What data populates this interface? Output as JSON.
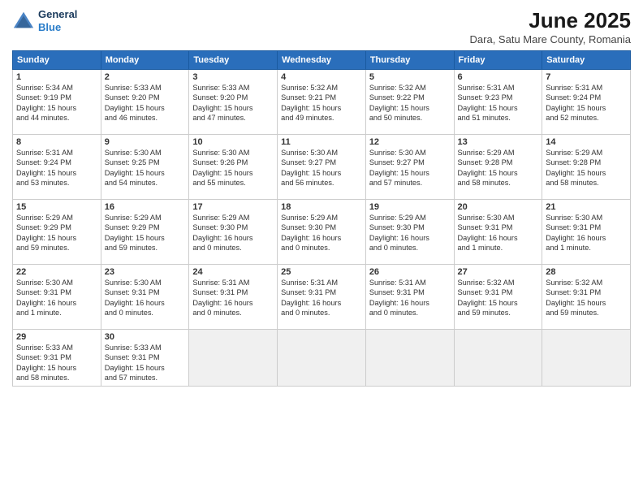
{
  "header": {
    "logo_line1": "General",
    "logo_line2": "Blue",
    "month": "June 2025",
    "location": "Dara, Satu Mare County, Romania"
  },
  "weekdays": [
    "Sunday",
    "Monday",
    "Tuesday",
    "Wednesday",
    "Thursday",
    "Friday",
    "Saturday"
  ],
  "weeks": [
    [
      {
        "day": "1",
        "text": "Sunrise: 5:34 AM\nSunset: 9:19 PM\nDaylight: 15 hours\nand 44 minutes."
      },
      {
        "day": "2",
        "text": "Sunrise: 5:33 AM\nSunset: 9:20 PM\nDaylight: 15 hours\nand 46 minutes."
      },
      {
        "day": "3",
        "text": "Sunrise: 5:33 AM\nSunset: 9:20 PM\nDaylight: 15 hours\nand 47 minutes."
      },
      {
        "day": "4",
        "text": "Sunrise: 5:32 AM\nSunset: 9:21 PM\nDaylight: 15 hours\nand 49 minutes."
      },
      {
        "day": "5",
        "text": "Sunrise: 5:32 AM\nSunset: 9:22 PM\nDaylight: 15 hours\nand 50 minutes."
      },
      {
        "day": "6",
        "text": "Sunrise: 5:31 AM\nSunset: 9:23 PM\nDaylight: 15 hours\nand 51 minutes."
      },
      {
        "day": "7",
        "text": "Sunrise: 5:31 AM\nSunset: 9:24 PM\nDaylight: 15 hours\nand 52 minutes."
      }
    ],
    [
      {
        "day": "8",
        "text": "Sunrise: 5:31 AM\nSunset: 9:24 PM\nDaylight: 15 hours\nand 53 minutes."
      },
      {
        "day": "9",
        "text": "Sunrise: 5:30 AM\nSunset: 9:25 PM\nDaylight: 15 hours\nand 54 minutes."
      },
      {
        "day": "10",
        "text": "Sunrise: 5:30 AM\nSunset: 9:26 PM\nDaylight: 15 hours\nand 55 minutes."
      },
      {
        "day": "11",
        "text": "Sunrise: 5:30 AM\nSunset: 9:27 PM\nDaylight: 15 hours\nand 56 minutes."
      },
      {
        "day": "12",
        "text": "Sunrise: 5:30 AM\nSunset: 9:27 PM\nDaylight: 15 hours\nand 57 minutes."
      },
      {
        "day": "13",
        "text": "Sunrise: 5:29 AM\nSunset: 9:28 PM\nDaylight: 15 hours\nand 58 minutes."
      },
      {
        "day": "14",
        "text": "Sunrise: 5:29 AM\nSunset: 9:28 PM\nDaylight: 15 hours\nand 58 minutes."
      }
    ],
    [
      {
        "day": "15",
        "text": "Sunrise: 5:29 AM\nSunset: 9:29 PM\nDaylight: 15 hours\nand 59 minutes."
      },
      {
        "day": "16",
        "text": "Sunrise: 5:29 AM\nSunset: 9:29 PM\nDaylight: 15 hours\nand 59 minutes."
      },
      {
        "day": "17",
        "text": "Sunrise: 5:29 AM\nSunset: 9:30 PM\nDaylight: 16 hours\nand 0 minutes."
      },
      {
        "day": "18",
        "text": "Sunrise: 5:29 AM\nSunset: 9:30 PM\nDaylight: 16 hours\nand 0 minutes."
      },
      {
        "day": "19",
        "text": "Sunrise: 5:29 AM\nSunset: 9:30 PM\nDaylight: 16 hours\nand 0 minutes."
      },
      {
        "day": "20",
        "text": "Sunrise: 5:30 AM\nSunset: 9:31 PM\nDaylight: 16 hours\nand 1 minute."
      },
      {
        "day": "21",
        "text": "Sunrise: 5:30 AM\nSunset: 9:31 PM\nDaylight: 16 hours\nand 1 minute."
      }
    ],
    [
      {
        "day": "22",
        "text": "Sunrise: 5:30 AM\nSunset: 9:31 PM\nDaylight: 16 hours\nand 1 minute."
      },
      {
        "day": "23",
        "text": "Sunrise: 5:30 AM\nSunset: 9:31 PM\nDaylight: 16 hours\nand 0 minutes."
      },
      {
        "day": "24",
        "text": "Sunrise: 5:31 AM\nSunset: 9:31 PM\nDaylight: 16 hours\nand 0 minutes."
      },
      {
        "day": "25",
        "text": "Sunrise: 5:31 AM\nSunset: 9:31 PM\nDaylight: 16 hours\nand 0 minutes."
      },
      {
        "day": "26",
        "text": "Sunrise: 5:31 AM\nSunset: 9:31 PM\nDaylight: 16 hours\nand 0 minutes."
      },
      {
        "day": "27",
        "text": "Sunrise: 5:32 AM\nSunset: 9:31 PM\nDaylight: 15 hours\nand 59 minutes."
      },
      {
        "day": "28",
        "text": "Sunrise: 5:32 AM\nSunset: 9:31 PM\nDaylight: 15 hours\nand 59 minutes."
      }
    ],
    [
      {
        "day": "29",
        "text": "Sunrise: 5:33 AM\nSunset: 9:31 PM\nDaylight: 15 hours\nand 58 minutes."
      },
      {
        "day": "30",
        "text": "Sunrise: 5:33 AM\nSunset: 9:31 PM\nDaylight: 15 hours\nand 57 minutes."
      },
      {
        "day": "",
        "text": ""
      },
      {
        "day": "",
        "text": ""
      },
      {
        "day": "",
        "text": ""
      },
      {
        "day": "",
        "text": ""
      },
      {
        "day": "",
        "text": ""
      }
    ]
  ]
}
